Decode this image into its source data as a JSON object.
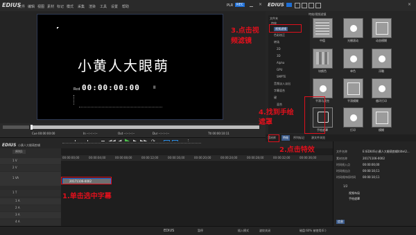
{
  "app": {
    "title": "EDIUS",
    "menu": [
      "文件",
      "编辑",
      "视图",
      "素材",
      "标记",
      "模式",
      "采集",
      "渲染",
      "工具",
      "设置",
      "帮助"
    ],
    "plr_label": "PLR",
    "rec_label": "REC"
  },
  "preview": {
    "subtitle": "小黄人大眼萌",
    "timecode": "00:00:00:00",
    "rcd_label": "Rcd",
    "pause_mark": "II",
    "cue_label": "Cue 00:00:00:00",
    "in_label": "In --:--:--:--",
    "out_label": "Out --:--:--:--",
    "dur_label": "Dur --:--:--:--",
    "ttl_label": "Ttl 00:00:10:11"
  },
  "fx_panel": {
    "title": "EDIUS",
    "path": "特效/视频滤镜",
    "tree_header": "文件夹",
    "tree_items": [
      "特效",
      "视频滤镜",
      "色彩校正",
      "转场",
      "2D",
      "3D",
      "Alpha",
      "GPU",
      "SMPTE",
      "音频淡入淡出",
      "字幕混合",
      "键",
      "混合"
    ],
    "thumbs": [
      {
        "label": "中值"
      },
      {
        "label": "光栅滚动"
      },
      {
        "label": "动态模糊"
      },
      {
        "label": "块颜色"
      },
      {
        "label": "单色"
      },
      {
        "label": "浮雕"
      },
      {
        "label": "平滑马赛克"
      },
      {
        "label": "平滑模糊"
      },
      {
        "label": "循环打印"
      },
      {
        "label": "手绘遮罩"
      },
      {
        "label": "打印"
      },
      {
        "label": "模糊"
      }
    ],
    "tabs": [
      "素材库",
      "特效",
      "序列标记",
      "源文件浏览"
    ]
  },
  "timeline": {
    "seq_label": "小黄人大眼萌剪辑",
    "seq_name": "序列1",
    "tracks": [
      "1 V",
      "2 V",
      "1 VA",
      "1 T",
      "1 A",
      "2 A",
      "3 A",
      "4 A"
    ],
    "ruler": [
      "00:00:00;00",
      "00:00:04;00",
      "00:00:08;00",
      "00:00:12;00",
      "00:00:16;00",
      "00:00:20;00",
      "00:00:24;00",
      "00:00:28;00",
      "00:00:32;00",
      "00:00:36;00"
    ],
    "clip_label": "20171106-0002"
  },
  "info": {
    "file_label": "文件名称",
    "file_value": "E:\\EDIUS\\小黄人大眼萌剪辑\\title\\2...",
    "name_label": "素材名称",
    "name_value": "20171106-0002",
    "in_label": "时间线入点",
    "in_value": "00:00:00;00",
    "out_label": "时间线出点",
    "out_value": "00:00:10;11",
    "dur_label": "时间线持续时间",
    "dur_value": "00:00:10;11",
    "page": "1/2",
    "fx_items": [
      "视频布局",
      "手绘遮罩"
    ],
    "tab": "信息"
  },
  "status": {
    "left": "EDIUS",
    "items": [
      "暂停",
      "插入模式",
      "波纹关闭",
      "磁盘:60% 被使用(E:)"
    ]
  },
  "annotations": {
    "a1": "1.单击选中字幕",
    "a2": "2.点击特效",
    "a3_line1": "3.点击视",
    "a3_line2": "频滤镜",
    "a4_line1": "4.找到手绘",
    "a4_line2": "遮罩",
    "color": "#e0101c"
  }
}
